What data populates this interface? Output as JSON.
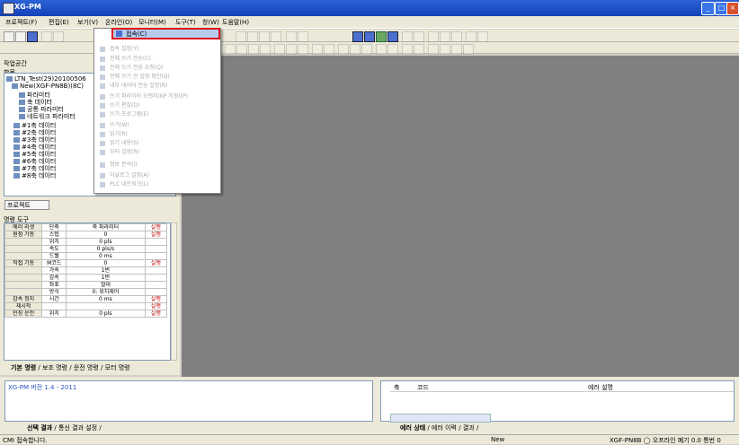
{
  "window": {
    "title": "XG-PM"
  },
  "menubar": {
    "items": [
      "프로젝트(F)",
      "편집(E)",
      "보기(V)",
      "온라인(O)",
      "모니터(M)",
      "도구(T)",
      "창(W)",
      "도움말(H)"
    ]
  },
  "workspace": {
    "title": "작업공간",
    "tree_header": "항목"
  },
  "tree": {
    "items": [
      {
        "label": "LTN_Test(29)20100506"
      },
      {
        "label": "New(XGF-PN8B)(8C)"
      },
      {
        "label": "파라미터"
      },
      {
        "label": "축 데이터"
      },
      {
        "label": "공통 파라미터"
      },
      {
        "label": "네트워크 파라미터"
      },
      {
        "label": "#1축 데이터"
      },
      {
        "label": "#2축 데이터"
      },
      {
        "label": "#3축 데이터"
      },
      {
        "label": "#4축 데이터"
      },
      {
        "label": "#5축 데이터"
      },
      {
        "label": "#6축 데이터"
      },
      {
        "label": "#7축 데이터"
      },
      {
        "label": "#8축 데이터"
      }
    ]
  },
  "project_button": "프로젝트",
  "options": {
    "title": "명령 도구",
    "rows": [
      [
        "에러 리셋",
        "단축",
        "축 파라미터",
        "실행"
      ],
      [
        "원점 기동",
        "스텝",
        "0",
        "실행"
      ],
      [
        "",
        "위치",
        "0 pls",
        ""
      ],
      [
        "",
        "속도",
        "0 pls/s",
        ""
      ],
      [
        "",
        "드웰",
        "0 ms",
        ""
      ],
      [
        "직접 기동",
        "M코드",
        "0",
        "실행"
      ],
      [
        "",
        "가속",
        "1번",
        ""
      ],
      [
        "",
        "감속",
        "1번",
        ""
      ],
      [
        "",
        "좌표",
        "절대",
        ""
      ],
      [
        "",
        "방식",
        "0: 위치제어",
        ""
      ],
      [
        "감속 정지",
        "시간",
        "0 ms",
        "실행"
      ],
      [
        "재시작",
        "",
        "",
        "실행"
      ],
      [
        "인칭 운전",
        "위치",
        "0 pls",
        "실행"
      ]
    ]
  },
  "left_tabs": {
    "items": [
      "기본 명령",
      "보조 명령",
      "운전 명령",
      "모터 명령"
    ]
  },
  "menu": {
    "selected": "접속(C)",
    "items": [
      "접속 설정(Y)",
      "전체 쓰기 전송(C)",
      "전체 쓰기 전송 요청(Q)",
      "전체 쓰기 전 설정 확인(Q)",
      "내부 데이터 전송 설정(R)",
      "쓰기 파라미터 오렌지(KP 저장)(P)",
      "쓰기 편집(D)",
      "쓰기 프로그램(E)",
      "쓰기(W)",
      "읽기(R)",
      "읽기 내용(S)",
      "모터 설정(R)",
      "정보 분석(I)",
      "아날로그 설정(A)",
      "PLC 네트워크(L)"
    ]
  },
  "output": {
    "version_text": "XG-PM 버전 1.4 - 2011"
  },
  "bottom_left_tabs": {
    "items": [
      "선택 결과",
      "통신 결과 설정"
    ]
  },
  "error_panel": {
    "columns": [
      "축",
      "코드",
      "에러 설명"
    ]
  },
  "bottom_right_tabs": {
    "items": [
      "에러 상태",
      "에러 이력",
      "결과"
    ]
  },
  "status": {
    "left": "CMI 접속합니다.",
    "mid": "New",
    "right": "XGF-PN8B  ◯  오프라인  폐기  0.0  통번 0"
  }
}
